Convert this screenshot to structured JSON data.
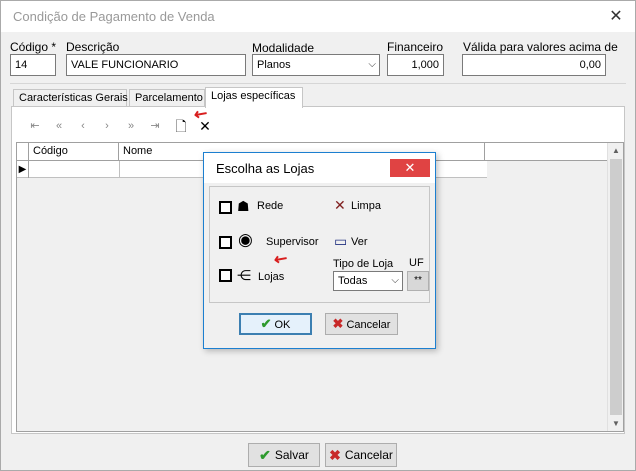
{
  "window": {
    "title": "Condição de Pagamento de Venda",
    "close_glyph": "✕"
  },
  "header": {
    "codigo": {
      "label": "Código *",
      "value": "14"
    },
    "descricao": {
      "label": "Descrição",
      "value": "VALE FUNCIONARIO"
    },
    "modalidade": {
      "label": "Modalidade",
      "value": "Planos"
    },
    "financeiro": {
      "label": "Financeiro",
      "value": "1,000"
    },
    "valida": {
      "label": "Válida para valores acima de",
      "value": "0,00"
    }
  },
  "tabs": [
    {
      "label": "Características Gerais"
    },
    {
      "label": "Parcelamento"
    },
    {
      "label": "Lojas específicas"
    }
  ],
  "grid": {
    "columns": [
      "Código",
      "Nome"
    ],
    "row_indicator": "▶"
  },
  "dialog": {
    "title": "Escolha as Lojas",
    "close_glyph": "✕",
    "options": {
      "rede": "Rede",
      "supervisor": "Supervisor",
      "lojas": "Lojas"
    },
    "actions": {
      "limpa": "Limpa",
      "ver": "Ver"
    },
    "tipo_loja": {
      "label": "Tipo de Loja",
      "value": "Todas"
    },
    "uf": {
      "label": "UF",
      "value": "**"
    },
    "ok_label": "OK",
    "cancel_label": "Cancelar"
  },
  "footer": {
    "save_label": "Salvar",
    "cancel_label": "Cancelar"
  },
  "colors": {
    "accent": "#1c7fd0",
    "close_red": "#e04343",
    "ok_green": "#2e9a2e",
    "cancel_red": "#c82828"
  }
}
